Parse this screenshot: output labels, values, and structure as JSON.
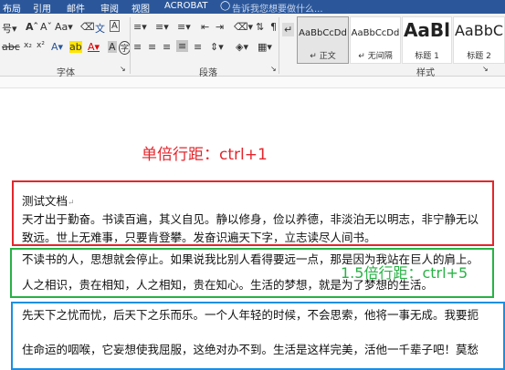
{
  "menu": {
    "items": [
      "布局",
      "引用",
      "邮件",
      "审阅",
      "视图",
      "ACROBAT"
    ],
    "tell_me": "告诉我您想要做什么..."
  },
  "ribbon": {
    "font_size_value": "号",
    "font_group_label": "字体",
    "paragraph_group_label": "段落",
    "styles_group_label": "样式",
    "styles": [
      {
        "preview": "AaBbCcDd",
        "name": "正文",
        "selected": true
      },
      {
        "preview": "AaBbCcDd",
        "name": "无间隔",
        "selected": false
      },
      {
        "preview": "AaBl",
        "name": "标题 1",
        "selected": false
      },
      {
        "preview": "AaBbC",
        "name": "标题 2",
        "selected": false
      }
    ]
  },
  "document": {
    "title_line": "测试文档",
    "lines": [
      "天才出于勤奋。书读百遍，其义自见。静以修身，俭以养德，非淡泊无以明志，非宁静无以",
      "致远。世上无难事，只要肯登攀。发奋识遍天下字，立志读尽人间书。",
      "不读书的人，思想就会停止。如果说我比别人看得要远一点，那是因为我站在巨人的肩上。",
      "人之相识，贵在相知，人之相知，贵在知心。生活的梦想，就是为了梦想的生活。",
      "先天下之忧而忧，后天下之乐而乐。一个人年轻的时候，不会思索，他将一事无成。我要扼",
      "住命运的咽喉，它妄想使我屈服，这绝对办不到。生活是这样完美，活他一千辈子吧！莫愁"
    ]
  },
  "annotations": {
    "single_spacing": "单倍行距：ctrl+1",
    "one_half_spacing": "1.5倍行距：ctrl+5"
  },
  "colors": {
    "menu_bg": "#2b579a",
    "red": "#e3262c",
    "green": "#27b244",
    "blue": "#1a8fe3"
  }
}
